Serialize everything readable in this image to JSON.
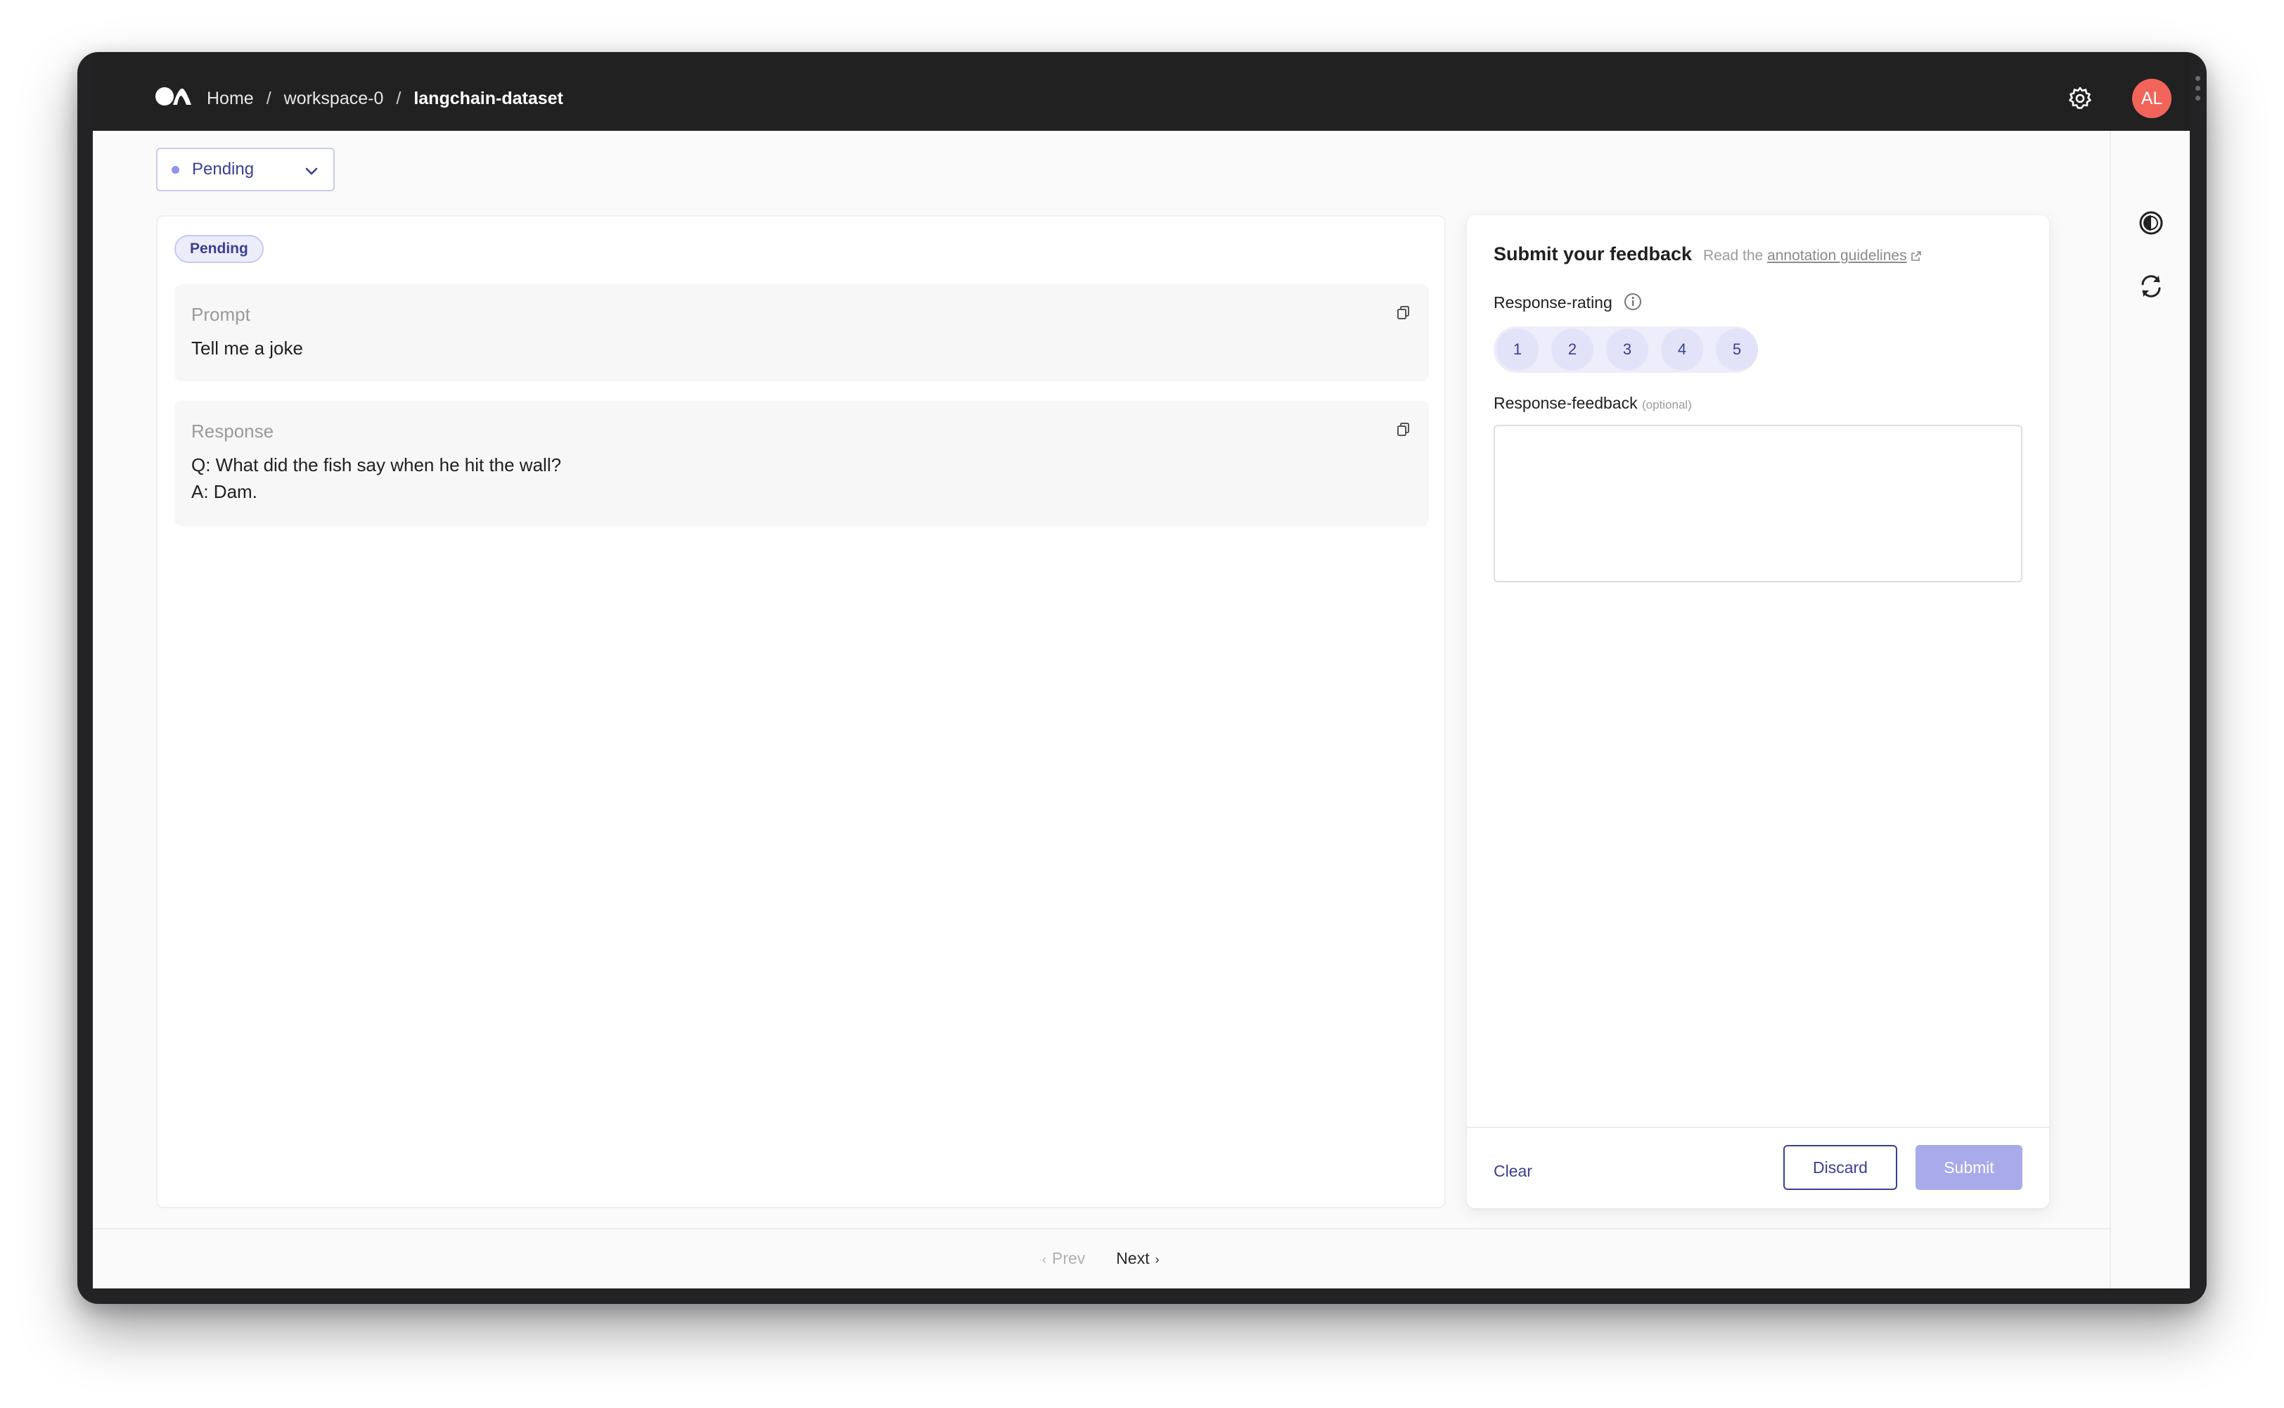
{
  "breadcrumb": {
    "home": "Home",
    "separator": "/",
    "workspace": "workspace-0",
    "dataset": "langchain-dataset"
  },
  "user": {
    "initials": "AL"
  },
  "icons": {
    "logo": "logo-icon",
    "settings": "gear-icon",
    "theme": "contrast-icon",
    "refresh": "refresh-icon",
    "copy": "copy-icon",
    "info": "info-icon",
    "external_link": "external-link-icon",
    "chevron": "chevron-down-icon"
  },
  "status_filter": {
    "selected": "Pending"
  },
  "record": {
    "status_badge": "Pending",
    "fields": [
      {
        "title": "Prompt",
        "text": "Tell me a joke"
      },
      {
        "title": "Response",
        "text": "Q: What did the fish say when he hit the wall?\nA: Dam."
      }
    ]
  },
  "feedback": {
    "title": "Submit your feedback",
    "guidelines_prefix": "Read the",
    "guidelines_link": "annotation guidelines",
    "rating_label": "Response-rating",
    "rating_options": [
      "1",
      "2",
      "3",
      "4",
      "5"
    ],
    "text_label": "Response-feedback",
    "text_optional": "(optional)",
    "text_value": "",
    "clear_label": "Clear",
    "discard_label": "Discard",
    "submit_label": "Submit"
  },
  "pagination": {
    "prev_label": "Prev",
    "next_label": "Next"
  },
  "colors": {
    "accent": "#3b3f8f",
    "submit_disabled": "#a9aaea",
    "avatar": "#f2645a",
    "topbar": "#212121"
  }
}
